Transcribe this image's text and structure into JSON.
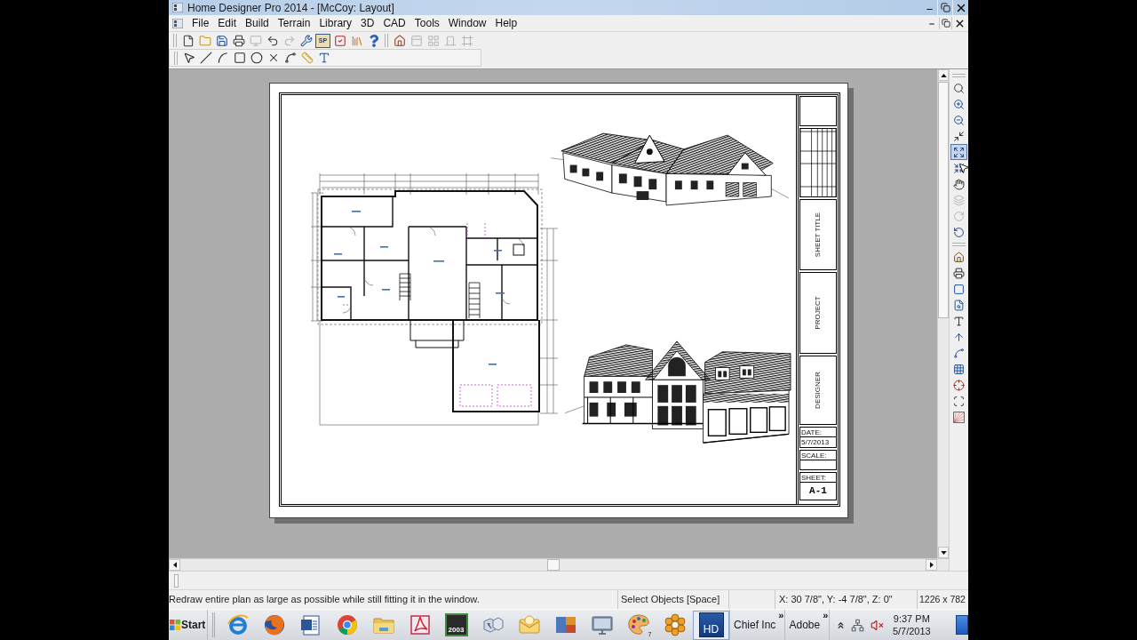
{
  "window": {
    "title": "Home Designer Pro 2014 - [McCoy: Layout]"
  },
  "menu": [
    "File",
    "Edit",
    "Build",
    "Terrain",
    "Library",
    "3D",
    "CAD",
    "Tools",
    "Window",
    "Help"
  ],
  "toolbar_main": {
    "groups": [
      {
        "items": [
          {
            "kind": "new",
            "disabled": false
          },
          {
            "kind": "open",
            "disabled": false
          },
          {
            "kind": "save",
            "disabled": false
          },
          {
            "kind": "print",
            "disabled": false
          },
          {
            "kind": "monitor",
            "disabled": true
          },
          {
            "kind": "undo",
            "disabled": false
          },
          {
            "kind": "redo",
            "disabled": true
          },
          {
            "kind": "tools",
            "disabled": false
          },
          {
            "kind": "sp",
            "label": "SP",
            "disabled": false
          },
          {
            "kind": "checklist",
            "disabled": false
          },
          {
            "kind": "library",
            "disabled": false
          },
          {
            "kind": "help",
            "disabled": false
          }
        ]
      },
      {
        "items": [
          {
            "kind": "house",
            "disabled": false
          },
          {
            "kind": "panel",
            "disabled": true
          },
          {
            "kind": "grid",
            "disabled": true
          },
          {
            "kind": "door",
            "disabled": true
          },
          {
            "kind": "frame",
            "disabled": true
          }
        ]
      }
    ]
  },
  "toolbar_draw": {
    "items": [
      {
        "kind": "select"
      },
      {
        "kind": "line"
      },
      {
        "kind": "arc"
      },
      {
        "kind": "rectangle"
      },
      {
        "kind": "circle"
      },
      {
        "kind": "delete"
      },
      {
        "kind": "spline"
      },
      {
        "kind": "dimension"
      },
      {
        "kind": "text"
      }
    ]
  },
  "right_toolbar": {
    "groups": [
      {
        "items": [
          {
            "kind": "zoom",
            "disabled": false,
            "pressed": false
          },
          {
            "kind": "zoom_in",
            "disabled": false,
            "pressed": false
          },
          {
            "kind": "zoom_out",
            "disabled": false,
            "pressed": false
          },
          {
            "kind": "zoom_box",
            "disabled": false,
            "pressed": false
          },
          {
            "kind": "fill_window",
            "disabled": false,
            "pressed": true
          },
          {
            "kind": "fit",
            "disabled": false,
            "pressed": false
          },
          {
            "kind": "pan",
            "disabled": false,
            "pressed": false
          },
          {
            "kind": "layers",
            "disabled": true,
            "pressed": false
          },
          {
            "kind": "redo_view",
            "disabled": true,
            "pressed": false
          },
          {
            "kind": "undo_view",
            "disabled": false,
            "pressed": false
          }
        ]
      },
      {
        "items": [
          {
            "kind": "camera_house",
            "disabled": false,
            "pressed": false
          },
          {
            "kind": "plot",
            "disabled": false,
            "pressed": false
          },
          {
            "kind": "page",
            "disabled": false,
            "pressed": false
          },
          {
            "kind": "find",
            "disabled": false,
            "pressed": false
          },
          {
            "kind": "text_arrow",
            "disabled": false,
            "pressed": false
          },
          {
            "kind": "raise",
            "disabled": false,
            "pressed": false
          },
          {
            "kind": "curve",
            "disabled": false,
            "pressed": false
          },
          {
            "kind": "grid3",
            "disabled": false,
            "pressed": false
          },
          {
            "kind": "snap",
            "disabled": false,
            "pressed": false
          },
          {
            "kind": "frame2",
            "disabled": false,
            "pressed": false
          },
          {
            "kind": "fan",
            "disabled": false,
            "pressed": false
          }
        ]
      }
    ]
  },
  "sheet": {
    "title_block": {
      "sheet_title": "SHEET TITLE",
      "project": "PROJECT",
      "designer": "DESIGNER",
      "date_label": "DATE:",
      "date": "5/7/2013",
      "scale_label": "SCALE:",
      "sheet_label": "SHEET:",
      "sheet_number": "A-1"
    }
  },
  "status_bar": {
    "message": "Redraw entire plan as large as possible while still fitting it in the window.",
    "mode": "Select Objects [Space]",
    "coordinates": "X: 30 7/8\", Y: -4 7/8\", Z: 0\"",
    "size": "1226 x 782"
  },
  "taskbar": {
    "start": "Start",
    "apps": [
      {
        "kind": "ie",
        "active": false
      },
      {
        "kind": "firefox",
        "active": false
      },
      {
        "kind": "word",
        "active": false
      },
      {
        "kind": "chrome",
        "active": false
      },
      {
        "kind": "folder",
        "active": false
      },
      {
        "kind": "acrobat",
        "active": false
      },
      {
        "kind": "quicken",
        "label": "2003",
        "active": false
      },
      {
        "kind": "cubes",
        "active": false
      },
      {
        "kind": "mail",
        "active": false
      },
      {
        "kind": "tiles",
        "active": false
      },
      {
        "kind": "tv",
        "active": false
      },
      {
        "kind": "palette",
        "badge": "7",
        "active": false
      },
      {
        "kind": "flower",
        "active": false
      },
      {
        "kind": "hd",
        "label": "HD",
        "active": true
      }
    ],
    "toolbars": [
      {
        "label": "Chief Inc",
        "chevron": "»"
      },
      {
        "label": "Adobe",
        "chevron": "»"
      }
    ],
    "clock": {
      "time": "9:37 PM",
      "date": "5/7/2013"
    }
  }
}
